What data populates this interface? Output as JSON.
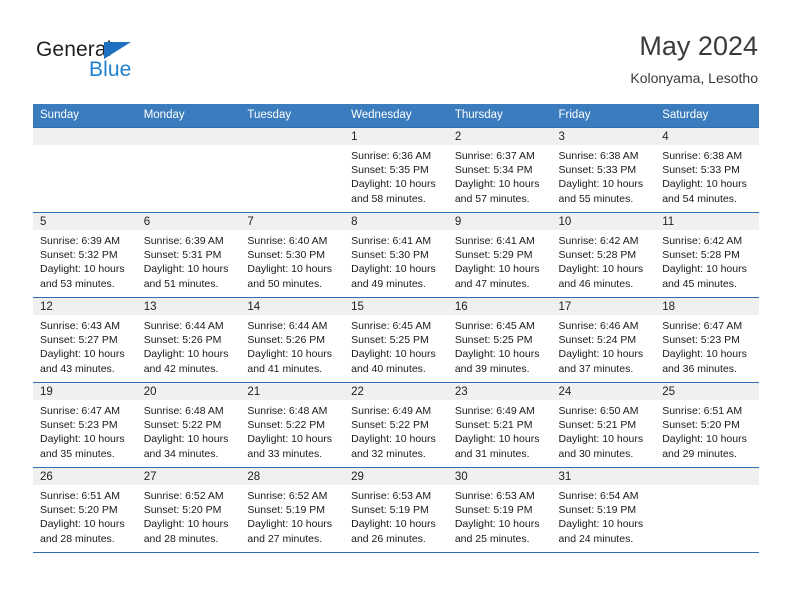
{
  "brand": {
    "name_part1": "General",
    "name_part2": "Blue",
    "flag_icon": "blue-triangle-flag-icon"
  },
  "header": {
    "title": "May 2024",
    "subtitle": "Kolonyama, Lesotho"
  },
  "colors": {
    "header_blue": "#3b7cbf",
    "grid_line": "#2f6fb0",
    "daynum_strip": "#f0f0f0",
    "brand_blue": "#1f80d0",
    "text": "#1a1a1a"
  },
  "weekday_headers": [
    "Sunday",
    "Monday",
    "Tuesday",
    "Wednesday",
    "Thursday",
    "Friday",
    "Saturday"
  ],
  "labels": {
    "sunrise_prefix": "Sunrise:",
    "sunset_prefix": "Sunset:",
    "daylight_prefix": "Daylight:"
  },
  "weeks": [
    [
      {
        "day": "",
        "line1": "",
        "line2": "",
        "line3": "",
        "line4": ""
      },
      {
        "day": "",
        "line1": "",
        "line2": "",
        "line3": "",
        "line4": ""
      },
      {
        "day": "",
        "line1": "",
        "line2": "",
        "line3": "",
        "line4": ""
      },
      {
        "day": "1",
        "line1": "Sunrise: 6:36 AM",
        "line2": "Sunset: 5:35 PM",
        "line3": "Daylight: 10 hours",
        "line4": "and 58 minutes."
      },
      {
        "day": "2",
        "line1": "Sunrise: 6:37 AM",
        "line2": "Sunset: 5:34 PM",
        "line3": "Daylight: 10 hours",
        "line4": "and 57 minutes."
      },
      {
        "day": "3",
        "line1": "Sunrise: 6:38 AM",
        "line2": "Sunset: 5:33 PM",
        "line3": "Daylight: 10 hours",
        "line4": "and 55 minutes."
      },
      {
        "day": "4",
        "line1": "Sunrise: 6:38 AM",
        "line2": "Sunset: 5:33 PM",
        "line3": "Daylight: 10 hours",
        "line4": "and 54 minutes."
      }
    ],
    [
      {
        "day": "5",
        "line1": "Sunrise: 6:39 AM",
        "line2": "Sunset: 5:32 PM",
        "line3": "Daylight: 10 hours",
        "line4": "and 53 minutes."
      },
      {
        "day": "6",
        "line1": "Sunrise: 6:39 AM",
        "line2": "Sunset: 5:31 PM",
        "line3": "Daylight: 10 hours",
        "line4": "and 51 minutes."
      },
      {
        "day": "7",
        "line1": "Sunrise: 6:40 AM",
        "line2": "Sunset: 5:30 PM",
        "line3": "Daylight: 10 hours",
        "line4": "and 50 minutes."
      },
      {
        "day": "8",
        "line1": "Sunrise: 6:41 AM",
        "line2": "Sunset: 5:30 PM",
        "line3": "Daylight: 10 hours",
        "line4": "and 49 minutes."
      },
      {
        "day": "9",
        "line1": "Sunrise: 6:41 AM",
        "line2": "Sunset: 5:29 PM",
        "line3": "Daylight: 10 hours",
        "line4": "and 47 minutes."
      },
      {
        "day": "10",
        "line1": "Sunrise: 6:42 AM",
        "line2": "Sunset: 5:28 PM",
        "line3": "Daylight: 10 hours",
        "line4": "and 46 minutes."
      },
      {
        "day": "11",
        "line1": "Sunrise: 6:42 AM",
        "line2": "Sunset: 5:28 PM",
        "line3": "Daylight: 10 hours",
        "line4": "and 45 minutes."
      }
    ],
    [
      {
        "day": "12",
        "line1": "Sunrise: 6:43 AM",
        "line2": "Sunset: 5:27 PM",
        "line3": "Daylight: 10 hours",
        "line4": "and 43 minutes."
      },
      {
        "day": "13",
        "line1": "Sunrise: 6:44 AM",
        "line2": "Sunset: 5:26 PM",
        "line3": "Daylight: 10 hours",
        "line4": "and 42 minutes."
      },
      {
        "day": "14",
        "line1": "Sunrise: 6:44 AM",
        "line2": "Sunset: 5:26 PM",
        "line3": "Daylight: 10 hours",
        "line4": "and 41 minutes."
      },
      {
        "day": "15",
        "line1": "Sunrise: 6:45 AM",
        "line2": "Sunset: 5:25 PM",
        "line3": "Daylight: 10 hours",
        "line4": "and 40 minutes."
      },
      {
        "day": "16",
        "line1": "Sunrise: 6:45 AM",
        "line2": "Sunset: 5:25 PM",
        "line3": "Daylight: 10 hours",
        "line4": "and 39 minutes."
      },
      {
        "day": "17",
        "line1": "Sunrise: 6:46 AM",
        "line2": "Sunset: 5:24 PM",
        "line3": "Daylight: 10 hours",
        "line4": "and 37 minutes."
      },
      {
        "day": "18",
        "line1": "Sunrise: 6:47 AM",
        "line2": "Sunset: 5:23 PM",
        "line3": "Daylight: 10 hours",
        "line4": "and 36 minutes."
      }
    ],
    [
      {
        "day": "19",
        "line1": "Sunrise: 6:47 AM",
        "line2": "Sunset: 5:23 PM",
        "line3": "Daylight: 10 hours",
        "line4": "and 35 minutes."
      },
      {
        "day": "20",
        "line1": "Sunrise: 6:48 AM",
        "line2": "Sunset: 5:22 PM",
        "line3": "Daylight: 10 hours",
        "line4": "and 34 minutes."
      },
      {
        "day": "21",
        "line1": "Sunrise: 6:48 AM",
        "line2": "Sunset: 5:22 PM",
        "line3": "Daylight: 10 hours",
        "line4": "and 33 minutes."
      },
      {
        "day": "22",
        "line1": "Sunrise: 6:49 AM",
        "line2": "Sunset: 5:22 PM",
        "line3": "Daylight: 10 hours",
        "line4": "and 32 minutes."
      },
      {
        "day": "23",
        "line1": "Sunrise: 6:49 AM",
        "line2": "Sunset: 5:21 PM",
        "line3": "Daylight: 10 hours",
        "line4": "and 31 minutes."
      },
      {
        "day": "24",
        "line1": "Sunrise: 6:50 AM",
        "line2": "Sunset: 5:21 PM",
        "line3": "Daylight: 10 hours",
        "line4": "and 30 minutes."
      },
      {
        "day": "25",
        "line1": "Sunrise: 6:51 AM",
        "line2": "Sunset: 5:20 PM",
        "line3": "Daylight: 10 hours",
        "line4": "and 29 minutes."
      }
    ],
    [
      {
        "day": "26",
        "line1": "Sunrise: 6:51 AM",
        "line2": "Sunset: 5:20 PM",
        "line3": "Daylight: 10 hours",
        "line4": "and 28 minutes."
      },
      {
        "day": "27",
        "line1": "Sunrise: 6:52 AM",
        "line2": "Sunset: 5:20 PM",
        "line3": "Daylight: 10 hours",
        "line4": "and 28 minutes."
      },
      {
        "day": "28",
        "line1": "Sunrise: 6:52 AM",
        "line2": "Sunset: 5:19 PM",
        "line3": "Daylight: 10 hours",
        "line4": "and 27 minutes."
      },
      {
        "day": "29",
        "line1": "Sunrise: 6:53 AM",
        "line2": "Sunset: 5:19 PM",
        "line3": "Daylight: 10 hours",
        "line4": "and 26 minutes."
      },
      {
        "day": "30",
        "line1": "Sunrise: 6:53 AM",
        "line2": "Sunset: 5:19 PM",
        "line3": "Daylight: 10 hours",
        "line4": "and 25 minutes."
      },
      {
        "day": "31",
        "line1": "Sunrise: 6:54 AM",
        "line2": "Sunset: 5:19 PM",
        "line3": "Daylight: 10 hours",
        "line4": "and 24 minutes."
      },
      {
        "day": "",
        "line1": "",
        "line2": "",
        "line3": "",
        "line4": ""
      }
    ]
  ]
}
